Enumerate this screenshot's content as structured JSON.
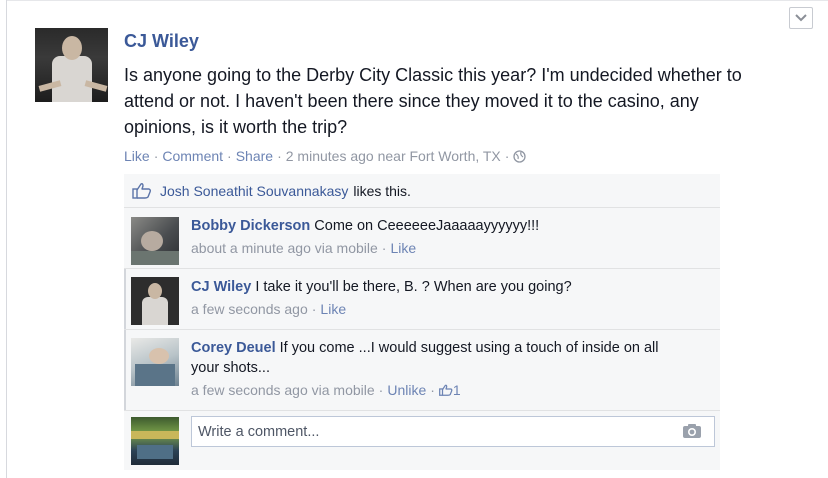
{
  "post": {
    "author": "CJ Wiley",
    "text": "Is anyone going to the Derby City Classic this year? I'm undecided whether to attend or not. I haven't been there since they moved it to the casino, any opinions, is it worth the trip?",
    "actions": {
      "like": "Like",
      "comment": "Comment",
      "share": "Share",
      "timestamp": "2 minutes ago near Fort Worth, TX",
      "separator": "·"
    },
    "options_icon": "chevron-down-icon",
    "privacy_icon": "globe-icon"
  },
  "likes": {
    "icon": "thumbs-up-icon",
    "name": "Josh Soneathit Souvannakasy",
    "text": "likes this."
  },
  "comments": [
    {
      "author": "Bobby Dickerson",
      "text": "Come on CeeeeeeJaaaaayyyyyy!!!",
      "time": "about a minute ago via mobile",
      "action": "Like"
    },
    {
      "author": "CJ Wiley",
      "text": "I take it you'll be there, B. ? When are you going?",
      "time": "a few seconds ago",
      "action": "Like"
    },
    {
      "author": "Corey Deuel",
      "text": "If you come ...I would suggest using a touch of inside on all your shots...",
      "time": "a few seconds ago via mobile",
      "action": "Unlike",
      "like_count": "1"
    }
  ],
  "composer": {
    "placeholder": "Write a comment...",
    "icon": "camera-icon"
  }
}
